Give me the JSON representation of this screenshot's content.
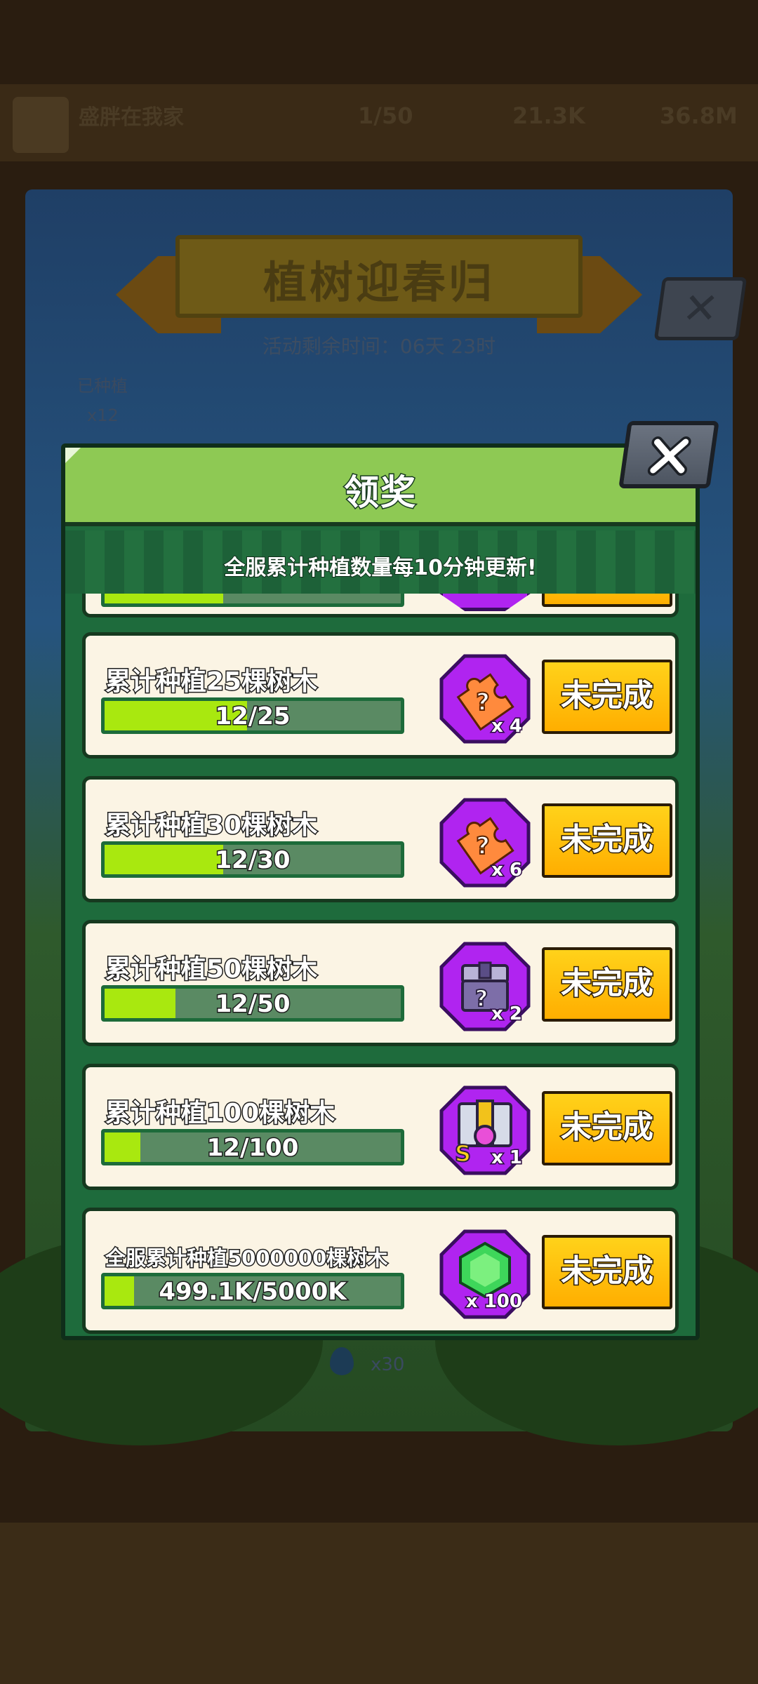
{
  "background": {
    "player_name": "盛胖在我家",
    "stat_1": "1/50",
    "stat_2": "21.3K",
    "stat_3": "36.8M",
    "event_title": "植树迎春归",
    "timer_text": "活动剩余时间：06天 23时",
    "planted_label": "已种植",
    "planted_count": "x12",
    "water_count": "x30"
  },
  "dialog": {
    "title": "领奖",
    "notice": "全服累计种植数量每10分钟更新!",
    "close_icon": "close-x-icon",
    "tasks": [
      {
        "label": "累计种植25棵树木",
        "progress_text": "12/25",
        "progress": 0.48,
        "reward_icon": "puzzle-piece-icon",
        "reward_qty": "x 4",
        "button": "未完成"
      },
      {
        "label": "累计种植30棵树木",
        "progress_text": "12/30",
        "progress": 0.4,
        "reward_icon": "puzzle-piece-icon",
        "reward_qty": "x 6",
        "button": "未完成"
      },
      {
        "label": "累计种植50棵树木",
        "progress_text": "12/50",
        "progress": 0.24,
        "reward_icon": "mystery-chest-icon",
        "reward_qty": "x 2",
        "button": "未完成"
      },
      {
        "label": "累计种植100棵树木",
        "progress_text": "12/100",
        "progress": 0.12,
        "reward_icon": "s-rank-equipment-icon",
        "reward_qty": "x 1",
        "button": "未完成"
      },
      {
        "label": "全服累计种植5000000棵树木",
        "progress_text": "499.1K/5000K",
        "progress": 0.1,
        "reward_icon": "green-gem-icon",
        "reward_qty": "x 100",
        "button": "未完成"
      }
    ]
  },
  "colors": {
    "panel_green": "#1e6b3c",
    "header_green": "#8ec954",
    "card_bg": "#fbf4e4",
    "progress_fill": "#a9e80f",
    "reward_purple": "#b024f0",
    "button_yellow": "#ffc000"
  }
}
